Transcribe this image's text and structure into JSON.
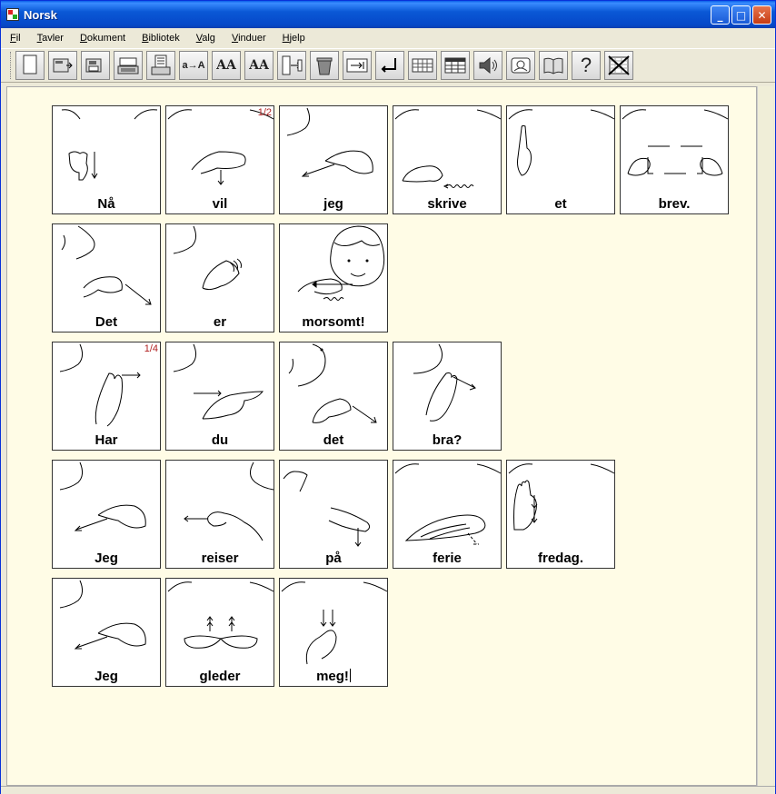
{
  "window": {
    "title": "Norsk"
  },
  "window_buttons": {
    "minimize": "_",
    "maximize": "□",
    "close": "✕"
  },
  "menu": [
    {
      "u": "F",
      "rest": "il"
    },
    {
      "u": "T",
      "rest": "avler"
    },
    {
      "u": "D",
      "rest": "okument"
    },
    {
      "u": "B",
      "rest": "ibliotek"
    },
    {
      "u": "V",
      "rest": "alg"
    },
    {
      "u": "V",
      "rest": "induer"
    },
    {
      "u": "H",
      "rest": "jelp"
    }
  ],
  "toolbar": {
    "text_tools": [
      "a→A",
      "AA",
      "AA"
    ],
    "help": "?"
  },
  "rows": [
    [
      {
        "word": "Nå",
        "badge": ""
      },
      {
        "word": "vil",
        "badge": "1/2"
      },
      {
        "word": "jeg",
        "badge": ""
      },
      {
        "word": "skrive",
        "badge": ""
      },
      {
        "word": "et",
        "badge": ""
      },
      {
        "word": "brev.",
        "badge": ""
      }
    ],
    [
      {
        "word": "Det",
        "badge": ""
      },
      {
        "word": "er",
        "badge": ""
      },
      {
        "word": "morsomt!",
        "badge": ""
      }
    ],
    [
      {
        "word": "Har",
        "badge": "1/4"
      },
      {
        "word": "du",
        "badge": ""
      },
      {
        "word": "det",
        "badge": ""
      },
      {
        "word": "bra?",
        "badge": ""
      }
    ],
    [
      {
        "word": "Jeg",
        "badge": ""
      },
      {
        "word": "reiser",
        "badge": ""
      },
      {
        "word": "på",
        "badge": ""
      },
      {
        "word": "ferie",
        "badge": ""
      },
      {
        "word": "fredag.",
        "badge": ""
      }
    ],
    [
      {
        "word": "Jeg",
        "badge": ""
      },
      {
        "word": "gleder",
        "badge": ""
      },
      {
        "word": "meg!",
        "badge": ""
      }
    ]
  ]
}
